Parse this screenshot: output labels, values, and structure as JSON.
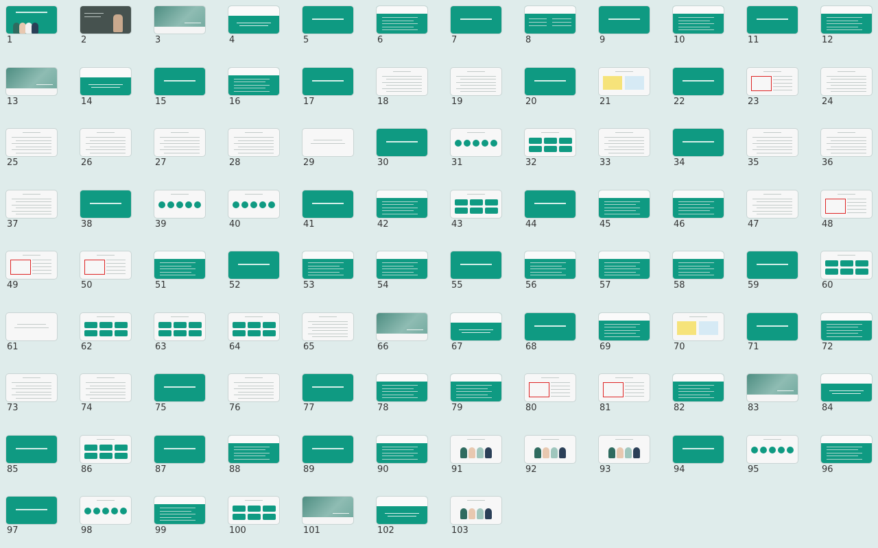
{
  "view": "slide-sorter",
  "background_color": "#dfeceb",
  "accent_color": "#0f9a82",
  "slides": [
    {
      "number": "1",
      "style": "green-cover"
    },
    {
      "number": "2",
      "style": "dark-photo"
    },
    {
      "number": "3",
      "style": "photo"
    },
    {
      "number": "4",
      "style": "white-band"
    },
    {
      "number": "5",
      "style": "green-title"
    },
    {
      "number": "6",
      "style": "white-band-lines"
    },
    {
      "number": "7",
      "style": "green-title"
    },
    {
      "number": "8",
      "style": "white-band-boxes"
    },
    {
      "number": "9",
      "style": "green-title"
    },
    {
      "number": "10",
      "style": "white-band-lines"
    },
    {
      "number": "11",
      "style": "green-title"
    },
    {
      "number": "12",
      "style": "white-band-lines"
    },
    {
      "number": "13",
      "style": "photo"
    },
    {
      "number": "14",
      "style": "white-band"
    },
    {
      "number": "15",
      "style": "green-title"
    },
    {
      "number": "16",
      "style": "white-band-lines"
    },
    {
      "number": "17",
      "style": "green-title"
    },
    {
      "number": "18",
      "style": "white-text"
    },
    {
      "number": "19",
      "style": "white-text"
    },
    {
      "number": "20",
      "style": "green-title"
    },
    {
      "number": "21",
      "style": "white-yellow"
    },
    {
      "number": "22",
      "style": "green-title"
    },
    {
      "number": "23",
      "style": "white-red"
    },
    {
      "number": "24",
      "style": "white-text"
    },
    {
      "number": "25",
      "style": "white-text"
    },
    {
      "number": "26",
      "style": "white-text"
    },
    {
      "number": "27",
      "style": "white-text"
    },
    {
      "number": "28",
      "style": "white-text"
    },
    {
      "number": "29",
      "style": "white-center"
    },
    {
      "number": "30",
      "style": "green-title"
    },
    {
      "number": "31",
      "style": "white-circles"
    },
    {
      "number": "32",
      "style": "white-boxes"
    },
    {
      "number": "33",
      "style": "white-text"
    },
    {
      "number": "34",
      "style": "green-title"
    },
    {
      "number": "35",
      "style": "white-text"
    },
    {
      "number": "36",
      "style": "white-text"
    },
    {
      "number": "37",
      "style": "white-text"
    },
    {
      "number": "38",
      "style": "green-title"
    },
    {
      "number": "39",
      "style": "white-circles"
    },
    {
      "number": "40",
      "style": "white-circles"
    },
    {
      "number": "41",
      "style": "green-title"
    },
    {
      "number": "42",
      "style": "white-band-lines"
    },
    {
      "number": "43",
      "style": "white-boxes"
    },
    {
      "number": "44",
      "style": "green-title"
    },
    {
      "number": "45",
      "style": "white-band-lines"
    },
    {
      "number": "46",
      "style": "white-band-lines"
    },
    {
      "number": "47",
      "style": "white-text"
    },
    {
      "number": "48",
      "style": "white-red"
    },
    {
      "number": "49",
      "style": "white-red"
    },
    {
      "number": "50",
      "style": "white-red"
    },
    {
      "number": "51",
      "style": "white-band-lines"
    },
    {
      "number": "52",
      "style": "green-title"
    },
    {
      "number": "53",
      "style": "white-band-lines"
    },
    {
      "number": "54",
      "style": "white-band-lines"
    },
    {
      "number": "55",
      "style": "green-title"
    },
    {
      "number": "56",
      "style": "white-band-lines"
    },
    {
      "number": "57",
      "style": "white-band-lines"
    },
    {
      "number": "58",
      "style": "white-band-lines"
    },
    {
      "number": "59",
      "style": "green-title"
    },
    {
      "number": "60",
      "style": "white-boxes"
    },
    {
      "number": "61",
      "style": "white-center"
    },
    {
      "number": "62",
      "style": "white-boxes"
    },
    {
      "number": "63",
      "style": "white-boxes"
    },
    {
      "number": "64",
      "style": "white-boxes"
    },
    {
      "number": "65",
      "style": "white-text"
    },
    {
      "number": "66",
      "style": "photo"
    },
    {
      "number": "67",
      "style": "white-band"
    },
    {
      "number": "68",
      "style": "green-title"
    },
    {
      "number": "69",
      "style": "white-band-lines"
    },
    {
      "number": "70",
      "style": "white-yellow"
    },
    {
      "number": "71",
      "style": "green-title"
    },
    {
      "number": "72",
      "style": "white-band-lines"
    },
    {
      "number": "73",
      "style": "white-text"
    },
    {
      "number": "74",
      "style": "white-text"
    },
    {
      "number": "75",
      "style": "green-title"
    },
    {
      "number": "76",
      "style": "white-text"
    },
    {
      "number": "77",
      "style": "green-title"
    },
    {
      "number": "78",
      "style": "white-band-lines"
    },
    {
      "number": "79",
      "style": "white-band-lines"
    },
    {
      "number": "80",
      "style": "white-red"
    },
    {
      "number": "81",
      "style": "white-red"
    },
    {
      "number": "82",
      "style": "white-band-lines"
    },
    {
      "number": "83",
      "style": "photo"
    },
    {
      "number": "84",
      "style": "white-band"
    },
    {
      "number": "85",
      "style": "green-title"
    },
    {
      "number": "86",
      "style": "white-boxes"
    },
    {
      "number": "87",
      "style": "green-title"
    },
    {
      "number": "88",
      "style": "white-band-lines"
    },
    {
      "number": "89",
      "style": "green-title"
    },
    {
      "number": "90",
      "style": "white-band-lines"
    },
    {
      "number": "91",
      "style": "white-people"
    },
    {
      "number": "92",
      "style": "white-people"
    },
    {
      "number": "93",
      "style": "white-people"
    },
    {
      "number": "94",
      "style": "green-title"
    },
    {
      "number": "95",
      "style": "white-circles"
    },
    {
      "number": "96",
      "style": "white-band-lines"
    },
    {
      "number": "97",
      "style": "green-title"
    },
    {
      "number": "98",
      "style": "white-circles"
    },
    {
      "number": "99",
      "style": "white-band-lines"
    },
    {
      "number": "100",
      "style": "white-boxes"
    },
    {
      "number": "101",
      "style": "photo"
    },
    {
      "number": "102",
      "style": "white-band"
    },
    {
      "number": "103",
      "style": "white-people"
    }
  ]
}
